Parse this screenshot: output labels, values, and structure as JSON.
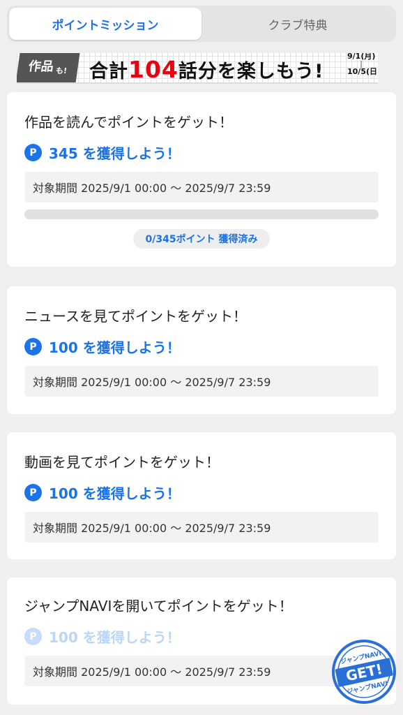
{
  "tabs": [
    {
      "label": "ポイントミッション",
      "active": true
    },
    {
      "label": "クラブ特典",
      "active": false
    }
  ],
  "banner": {
    "badge_main": "作品",
    "badge_sub": "も!",
    "headline_prefix": "合計",
    "headline_number": "104",
    "headline_suffix": "話分を楽しもう!",
    "date_start": "9/1(月)",
    "date_separator": "|",
    "date_end": "10/5(日)",
    "accent_color": "#e60012"
  },
  "missions": [
    {
      "title": "作品を読んでポイントをゲット！",
      "reward": "345 を獲得しよう！",
      "period": "対象期間 2025/9/1 00:00 〜 2025/9/7 23:59",
      "progress_fraction": 0,
      "progress_label": "0/345ポイント 獲得済み",
      "enabled": true
    },
    {
      "title": "ニュースを見てポイントをゲット！",
      "reward": "100 を獲得しよう！",
      "period": "対象期間 2025/9/1 00:00 〜 2025/9/7 23:59",
      "enabled": true
    },
    {
      "title": "動画を見てポイントをゲット！",
      "reward": "100 を獲得しよう！",
      "period": "対象期間 2025/9/1 00:00 〜 2025/9/7 23:59",
      "enabled": true
    },
    {
      "title": "ジャンプNAVIを開いてポイントをゲット！",
      "reward": "100 を獲得しよう！",
      "period": "対象期間 2025/9/1 00:00 〜 2025/9/7 23:59",
      "enabled": false
    }
  ],
  "point_icon_letter": "P",
  "stamp": {
    "top_text": "ジャンプNAVI",
    "main_text": "GET!",
    "bottom_text": "ジャンプNAVI",
    "color": "#2a6fd6"
  },
  "colors": {
    "accent": "#1a73e8",
    "background": "#efefef"
  }
}
